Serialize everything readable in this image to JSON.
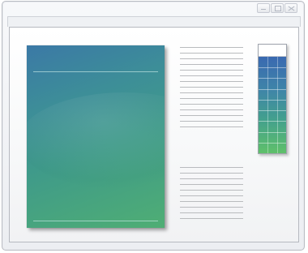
{
  "window": {
    "caption_buttons": [
      {
        "icon": "minimize-icon"
      },
      {
        "icon": "maximize-icon"
      },
      {
        "icon": "close-icon"
      }
    ]
  },
  "document": {
    "image_colors": {
      "top": "#3b79a6",
      "bottom": "#4fae74"
    },
    "text_block_upper_lines": 15,
    "text_block_lower_lines": 10
  },
  "swatch": {
    "colors": {
      "top": "#3a69b1",
      "bottom": "#5fc06a"
    }
  }
}
